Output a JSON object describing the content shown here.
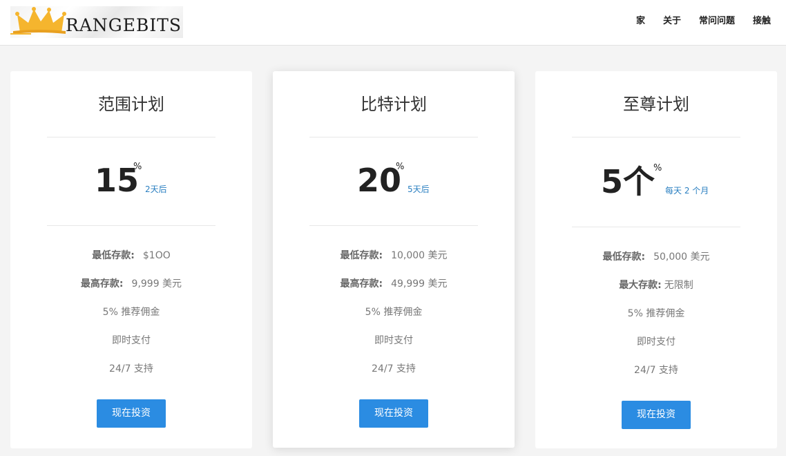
{
  "logo": {
    "text": "RANGEBITS"
  },
  "nav": [
    "家",
    "关于",
    "常问问题",
    "接触"
  ],
  "plans": [
    {
      "title": "范围计划",
      "rate": "15",
      "rate_suffix": "%",
      "period": "2天后",
      "min_label": "最低存款:",
      "min_value": "$1OO",
      "max_label": "最高存款:",
      "max_value": "9,999 美元",
      "commission": "5% 推荐佣金",
      "payout": "即时支付",
      "support": "24/7 支持",
      "button": "现在投资"
    },
    {
      "title": "比特计划",
      "rate": "20",
      "rate_suffix": "%",
      "period": "5天后",
      "min_label": "最低存款:",
      "min_value": "10,000 美元",
      "max_label": "最高存款:",
      "max_value": "49,999 美元",
      "commission": "5% 推荐佣金",
      "payout": "即时支付",
      "support": "24/7 支持",
      "button": "现在投资"
    },
    {
      "title": "至尊计划",
      "rate": "5个",
      "rate_suffix": "%",
      "period": "每天 2 个月",
      "min_label": "最低存款:",
      "min_value": "50,000 美元",
      "max_label": "最大存款:",
      "max_value": "无限制",
      "commission": "5% 推荐佣金",
      "payout": "即时支付",
      "support": "24/7 支持",
      "button": "现在投资"
    }
  ],
  "colors": {
    "accent": "#2b8ce2",
    "period_text": "#2a7fc1",
    "crown": "#f5b52e"
  },
  "icons": {
    "logo": "crown-icon"
  }
}
